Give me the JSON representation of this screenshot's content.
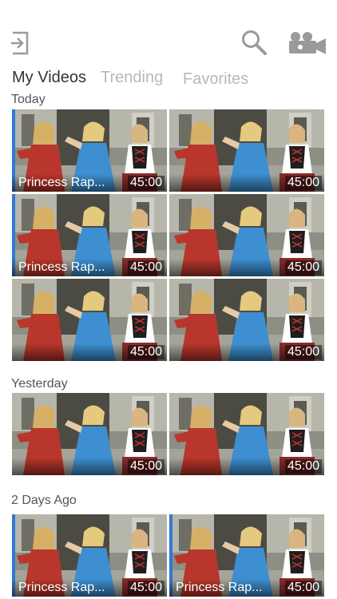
{
  "tabs": [
    {
      "label": "My Videos",
      "active": true
    },
    {
      "label": "Trending",
      "active": false
    },
    {
      "label": "Favorites",
      "active": false
    }
  ],
  "icons": {
    "logout": "logout-icon",
    "search": "search-icon",
    "camera": "video-camera-icon"
  },
  "colors": {
    "accent": "#2f78d6",
    "inactive_tab": "#b8b8b8",
    "icon_gray": "#9a9a9a"
  },
  "sections": [
    {
      "label": "Today",
      "videos": [
        {
          "title": "Princess Rap...",
          "duration": "45:00",
          "selected": true
        },
        {
          "title": "",
          "duration": "45:00",
          "selected": false
        },
        {
          "title": "Princess Rap...",
          "duration": "45:00",
          "selected": true
        },
        {
          "title": "",
          "duration": "45:00",
          "selected": false
        },
        {
          "title": "",
          "duration": "45:00",
          "selected": false
        },
        {
          "title": "",
          "duration": "45:00",
          "selected": false
        }
      ]
    },
    {
      "label": "Yesterday",
      "videos": [
        {
          "title": "",
          "duration": "45:00",
          "selected": false
        },
        {
          "title": "",
          "duration": "45:00",
          "selected": false
        }
      ]
    },
    {
      "label": "2 Days Ago",
      "videos": [
        {
          "title": "Princess Rap...",
          "duration": "45:00",
          "selected": true
        },
        {
          "title": "Princess Rap...",
          "duration": "45:00",
          "selected": true
        }
      ]
    }
  ]
}
